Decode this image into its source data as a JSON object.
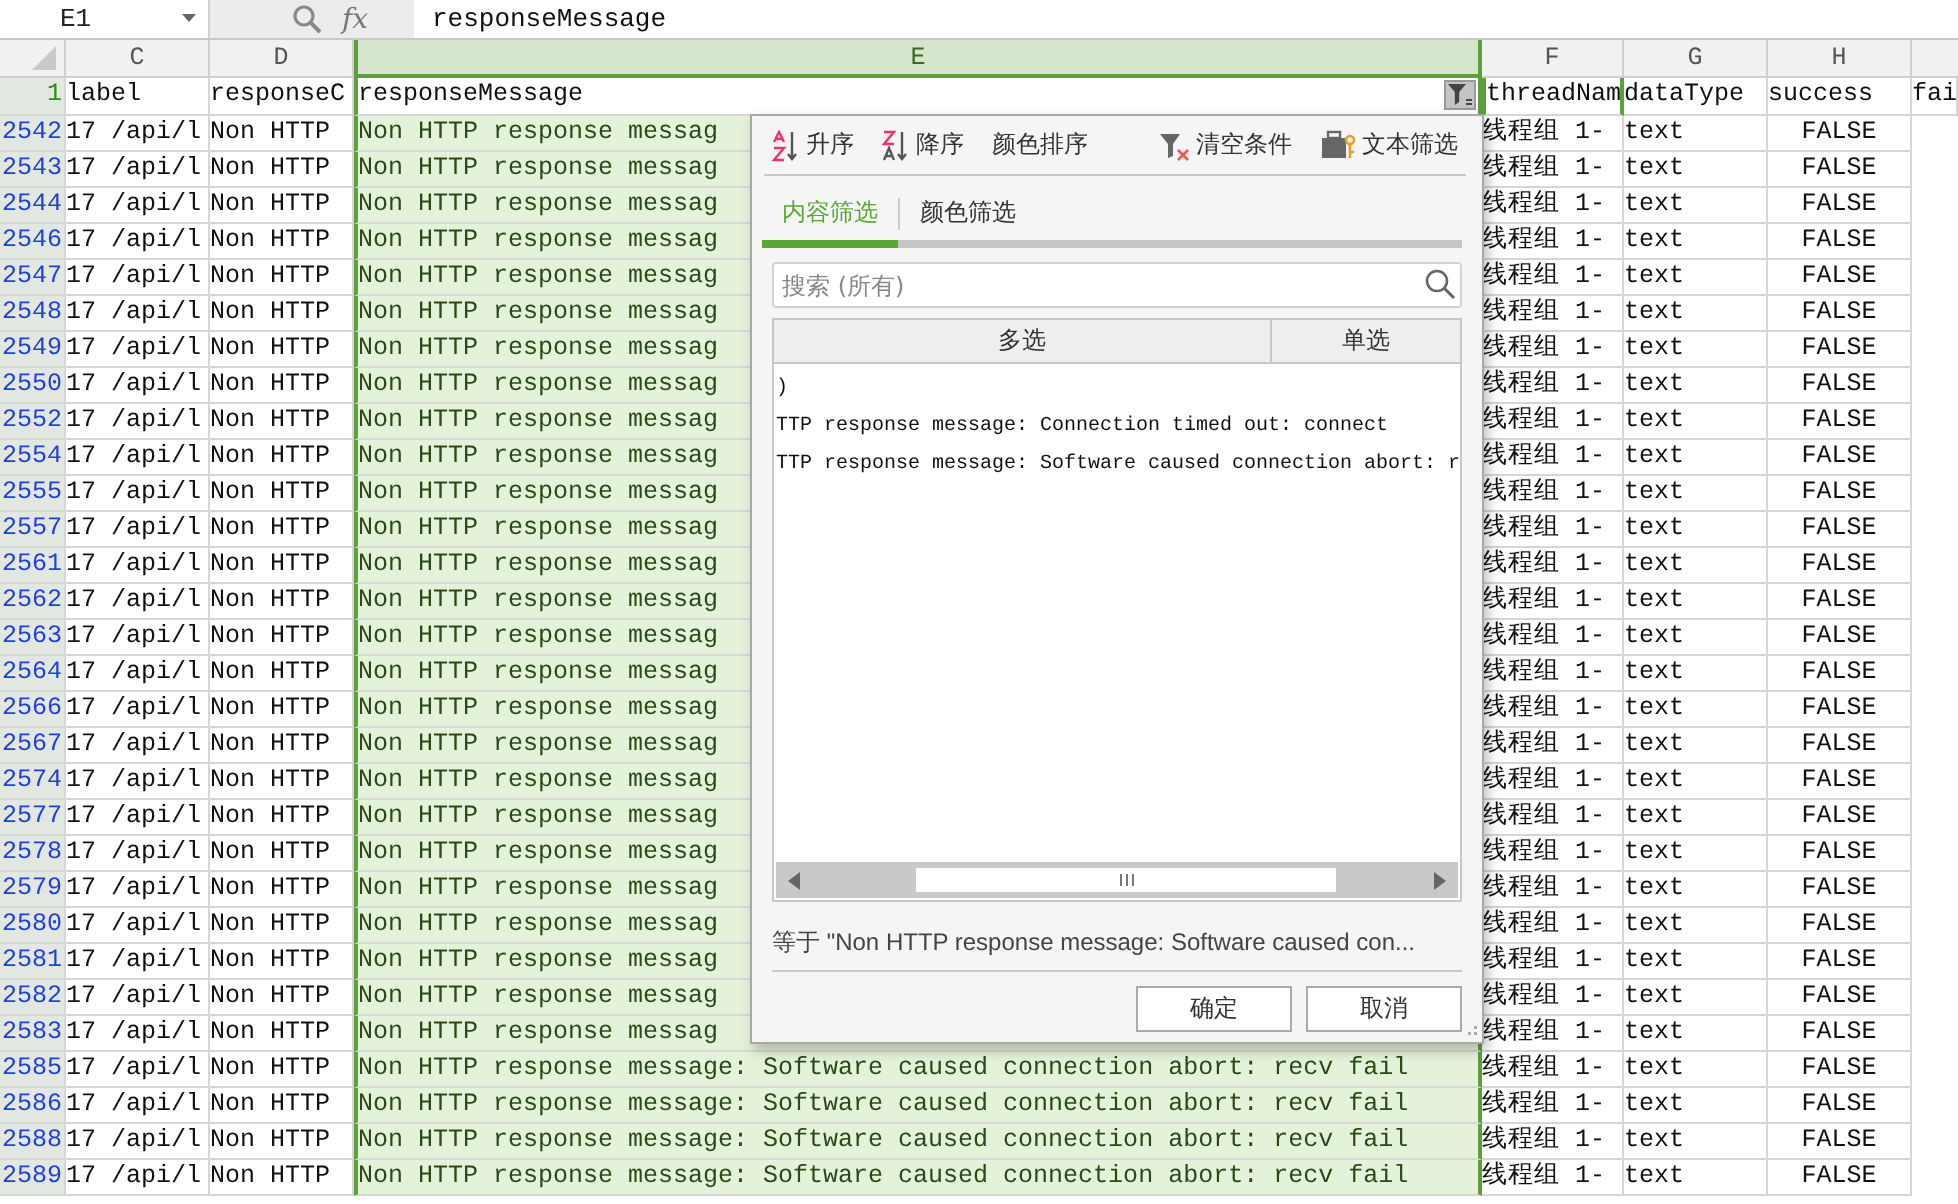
{
  "formula_bar": {
    "cell_name": "E1",
    "fx_label": "fx",
    "formula": "responseMessage"
  },
  "sheet": {
    "filtered": true,
    "columns": [
      {
        "label": "C",
        "selected": false
      },
      {
        "label": "D",
        "selected": false
      },
      {
        "label": "E",
        "selected": true
      },
      {
        "label": "F",
        "selected": false
      },
      {
        "label": "G",
        "selected": false
      },
      {
        "label": "H",
        "selected": false
      }
    ],
    "header_row": {
      "number": "1",
      "active": true,
      "cells": [
        "label",
        "responseC",
        "responseMessage",
        "threadNam",
        "dataType",
        "success",
        "fai"
      ]
    },
    "rows": [
      {
        "number": "2542",
        "cells": [
          "17 /api/l",
          "Non HTTP",
          "Non HTTP response messag",
          "线程组 1-",
          "text",
          "FALSE"
        ]
      },
      {
        "number": "2543",
        "cells": [
          "17 /api/l",
          "Non HTTP",
          "Non HTTP response messag",
          "线程组 1-",
          "text",
          "FALSE"
        ]
      },
      {
        "number": "2544",
        "cells": [
          "17 /api/l",
          "Non HTTP",
          "Non HTTP response messag",
          "线程组 1-",
          "text",
          "FALSE"
        ]
      },
      {
        "number": "2546",
        "cells": [
          "17 /api/l",
          "Non HTTP",
          "Non HTTP response messag",
          "线程组 1-",
          "text",
          "FALSE"
        ]
      },
      {
        "number": "2547",
        "cells": [
          "17 /api/l",
          "Non HTTP",
          "Non HTTP response messag",
          "线程组 1-",
          "text",
          "FALSE"
        ]
      },
      {
        "number": "2548",
        "cells": [
          "17 /api/l",
          "Non HTTP",
          "Non HTTP response messag",
          "线程组 1-",
          "text",
          "FALSE"
        ]
      },
      {
        "number": "2549",
        "cells": [
          "17 /api/l",
          "Non HTTP",
          "Non HTTP response messag",
          "线程组 1-",
          "text",
          "FALSE"
        ]
      },
      {
        "number": "2550",
        "cells": [
          "17 /api/l",
          "Non HTTP",
          "Non HTTP response messag",
          "线程组 1-",
          "text",
          "FALSE"
        ]
      },
      {
        "number": "2552",
        "cells": [
          "17 /api/l",
          "Non HTTP",
          "Non HTTP response messag",
          "线程组 1-",
          "text",
          "FALSE"
        ]
      },
      {
        "number": "2554",
        "cells": [
          "17 /api/l",
          "Non HTTP",
          "Non HTTP response messag",
          "线程组 1-",
          "text",
          "FALSE"
        ]
      },
      {
        "number": "2555",
        "cells": [
          "17 /api/l",
          "Non HTTP",
          "Non HTTP response messag",
          "线程组 1-",
          "text",
          "FALSE"
        ]
      },
      {
        "number": "2557",
        "cells": [
          "17 /api/l",
          "Non HTTP",
          "Non HTTP response messag",
          "线程组 1-",
          "text",
          "FALSE"
        ]
      },
      {
        "number": "2561",
        "cells": [
          "17 /api/l",
          "Non HTTP",
          "Non HTTP response messag",
          "线程组 1-",
          "text",
          "FALSE"
        ]
      },
      {
        "number": "2562",
        "cells": [
          "17 /api/l",
          "Non HTTP",
          "Non HTTP response messag",
          "线程组 1-",
          "text",
          "FALSE"
        ]
      },
      {
        "number": "2563",
        "cells": [
          "17 /api/l",
          "Non HTTP",
          "Non HTTP response messag",
          "线程组 1-",
          "text",
          "FALSE"
        ]
      },
      {
        "number": "2564",
        "cells": [
          "17 /api/l",
          "Non HTTP",
          "Non HTTP response messag",
          "线程组 1-",
          "text",
          "FALSE"
        ]
      },
      {
        "number": "2566",
        "cells": [
          "17 /api/l",
          "Non HTTP",
          "Non HTTP response messag",
          "线程组 1-",
          "text",
          "FALSE"
        ]
      },
      {
        "number": "2567",
        "cells": [
          "17 /api/l",
          "Non HTTP",
          "Non HTTP response messag",
          "线程组 1-",
          "text",
          "FALSE"
        ]
      },
      {
        "number": "2574",
        "cells": [
          "17 /api/l",
          "Non HTTP",
          "Non HTTP response messag",
          "线程组 1-",
          "text",
          "FALSE"
        ]
      },
      {
        "number": "2577",
        "cells": [
          "17 /api/l",
          "Non HTTP",
          "Non HTTP response messag",
          "线程组 1-",
          "text",
          "FALSE"
        ]
      },
      {
        "number": "2578",
        "cells": [
          "17 /api/l",
          "Non HTTP",
          "Non HTTP response messag",
          "线程组 1-",
          "text",
          "FALSE"
        ]
      },
      {
        "number": "2579",
        "cells": [
          "17 /api/l",
          "Non HTTP",
          "Non HTTP response messag",
          "线程组 1-",
          "text",
          "FALSE"
        ]
      },
      {
        "number": "2580",
        "cells": [
          "17 /api/l",
          "Non HTTP",
          "Non HTTP response messag",
          "线程组 1-",
          "text",
          "FALSE"
        ]
      },
      {
        "number": "2581",
        "cells": [
          "17 /api/l",
          "Non HTTP",
          "Non HTTP response messag",
          "线程组 1-",
          "text",
          "FALSE"
        ]
      },
      {
        "number": "2582",
        "cells": [
          "17 /api/l",
          "Non HTTP",
          "Non HTTP response messag",
          "线程组 1-",
          "text",
          "FALSE"
        ]
      },
      {
        "number": "2583",
        "cells": [
          "17 /api/l",
          "Non HTTP",
          "Non HTTP response messag",
          "线程组 1-",
          "text",
          "FALSE"
        ]
      },
      {
        "number": "2585",
        "cells": [
          "17 /api/l",
          "Non HTTP",
          "Non HTTP response message: Software caused connection abort: recv fail",
          "线程组 1-",
          "text",
          "FALSE"
        ]
      },
      {
        "number": "2586",
        "cells": [
          "17 /api/l",
          "Non HTTP",
          "Non HTTP response message: Software caused connection abort: recv fail",
          "线程组 1-",
          "text",
          "FALSE"
        ]
      },
      {
        "number": "2588",
        "cells": [
          "17 /api/l",
          "Non HTTP",
          "Non HTTP response message: Software caused connection abort: recv fail",
          "线程组 1-",
          "text",
          "FALSE"
        ]
      },
      {
        "number": "2589",
        "cells": [
          "17 /api/l",
          "Non HTTP",
          "Non HTTP response message: Software caused connection abort: recv fail",
          "线程组 1-",
          "text",
          "FALSE"
        ]
      }
    ]
  },
  "filter_dialog": {
    "toolbar": [
      {
        "kind": "sort-asc",
        "label": "升序"
      },
      {
        "kind": "sort-desc",
        "label": "降序"
      },
      {
        "kind": "color-sort",
        "label": "颜色排序"
      },
      {
        "kind": "clear",
        "label": "清空条件"
      },
      {
        "kind": "text-filter",
        "label": "文本筛选"
      }
    ],
    "tabs": [
      {
        "label": "内容筛选",
        "selected": true
      },
      {
        "label": "颜色筛选",
        "selected": false
      }
    ],
    "search": {
      "placeholder": "搜索 (所有)"
    },
    "list_columns": [
      "多选",
      "单选"
    ],
    "items": [
      ")",
      "TTP response message: Connection timed out: connect",
      "TTP response message: Software caused connection abort: r"
    ],
    "status": "等于 \"Non HTTP response message: Software caused con...",
    "buttons": [
      "确定",
      "取消"
    ]
  }
}
